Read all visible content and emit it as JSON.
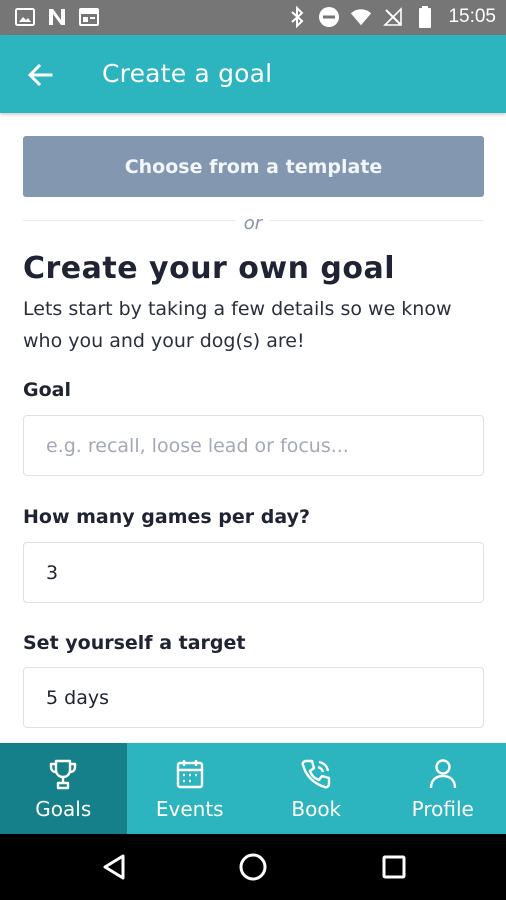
{
  "status_bar": {
    "time": "15:05",
    "left_icons": [
      "image-icon",
      "n-icon",
      "calendar-widget-icon"
    ],
    "right_icons": [
      "bluetooth-icon",
      "do-not-disturb-icon",
      "wifi-icon",
      "no-sim-icon",
      "battery-icon"
    ]
  },
  "app_bar": {
    "title": "Create a goal",
    "back_icon": "arrow-left-icon"
  },
  "content": {
    "template_button": "Choose from a template",
    "or_text": "or",
    "section_title": "Create your own goal",
    "section_description": "Lets start by taking a few details so we know who you and your dog(s) are!",
    "fields": [
      {
        "label": "Goal",
        "value": "",
        "placeholder": "e.g. recall, loose lead or focus..."
      },
      {
        "label": "How many games per day?",
        "value": "3",
        "placeholder": ""
      },
      {
        "label": "Set yourself a target",
        "value": "5 days",
        "placeholder": ""
      }
    ]
  },
  "bottom_nav": {
    "items": [
      {
        "label": "Goals",
        "icon": "trophy-icon",
        "active": true
      },
      {
        "label": "Events",
        "icon": "calendar-icon",
        "active": false
      },
      {
        "label": "Book",
        "icon": "phone-icon",
        "active": false
      },
      {
        "label": "Profile",
        "icon": "user-icon",
        "active": false
      }
    ]
  },
  "system_nav": {
    "icons": [
      "back-triangle-icon",
      "home-circle-icon",
      "recents-square-icon"
    ]
  },
  "colors": {
    "primary": "#2cb5bf",
    "primary_dark": "#16808a",
    "template_button": "#8397b1",
    "status_bar": "#767676"
  }
}
